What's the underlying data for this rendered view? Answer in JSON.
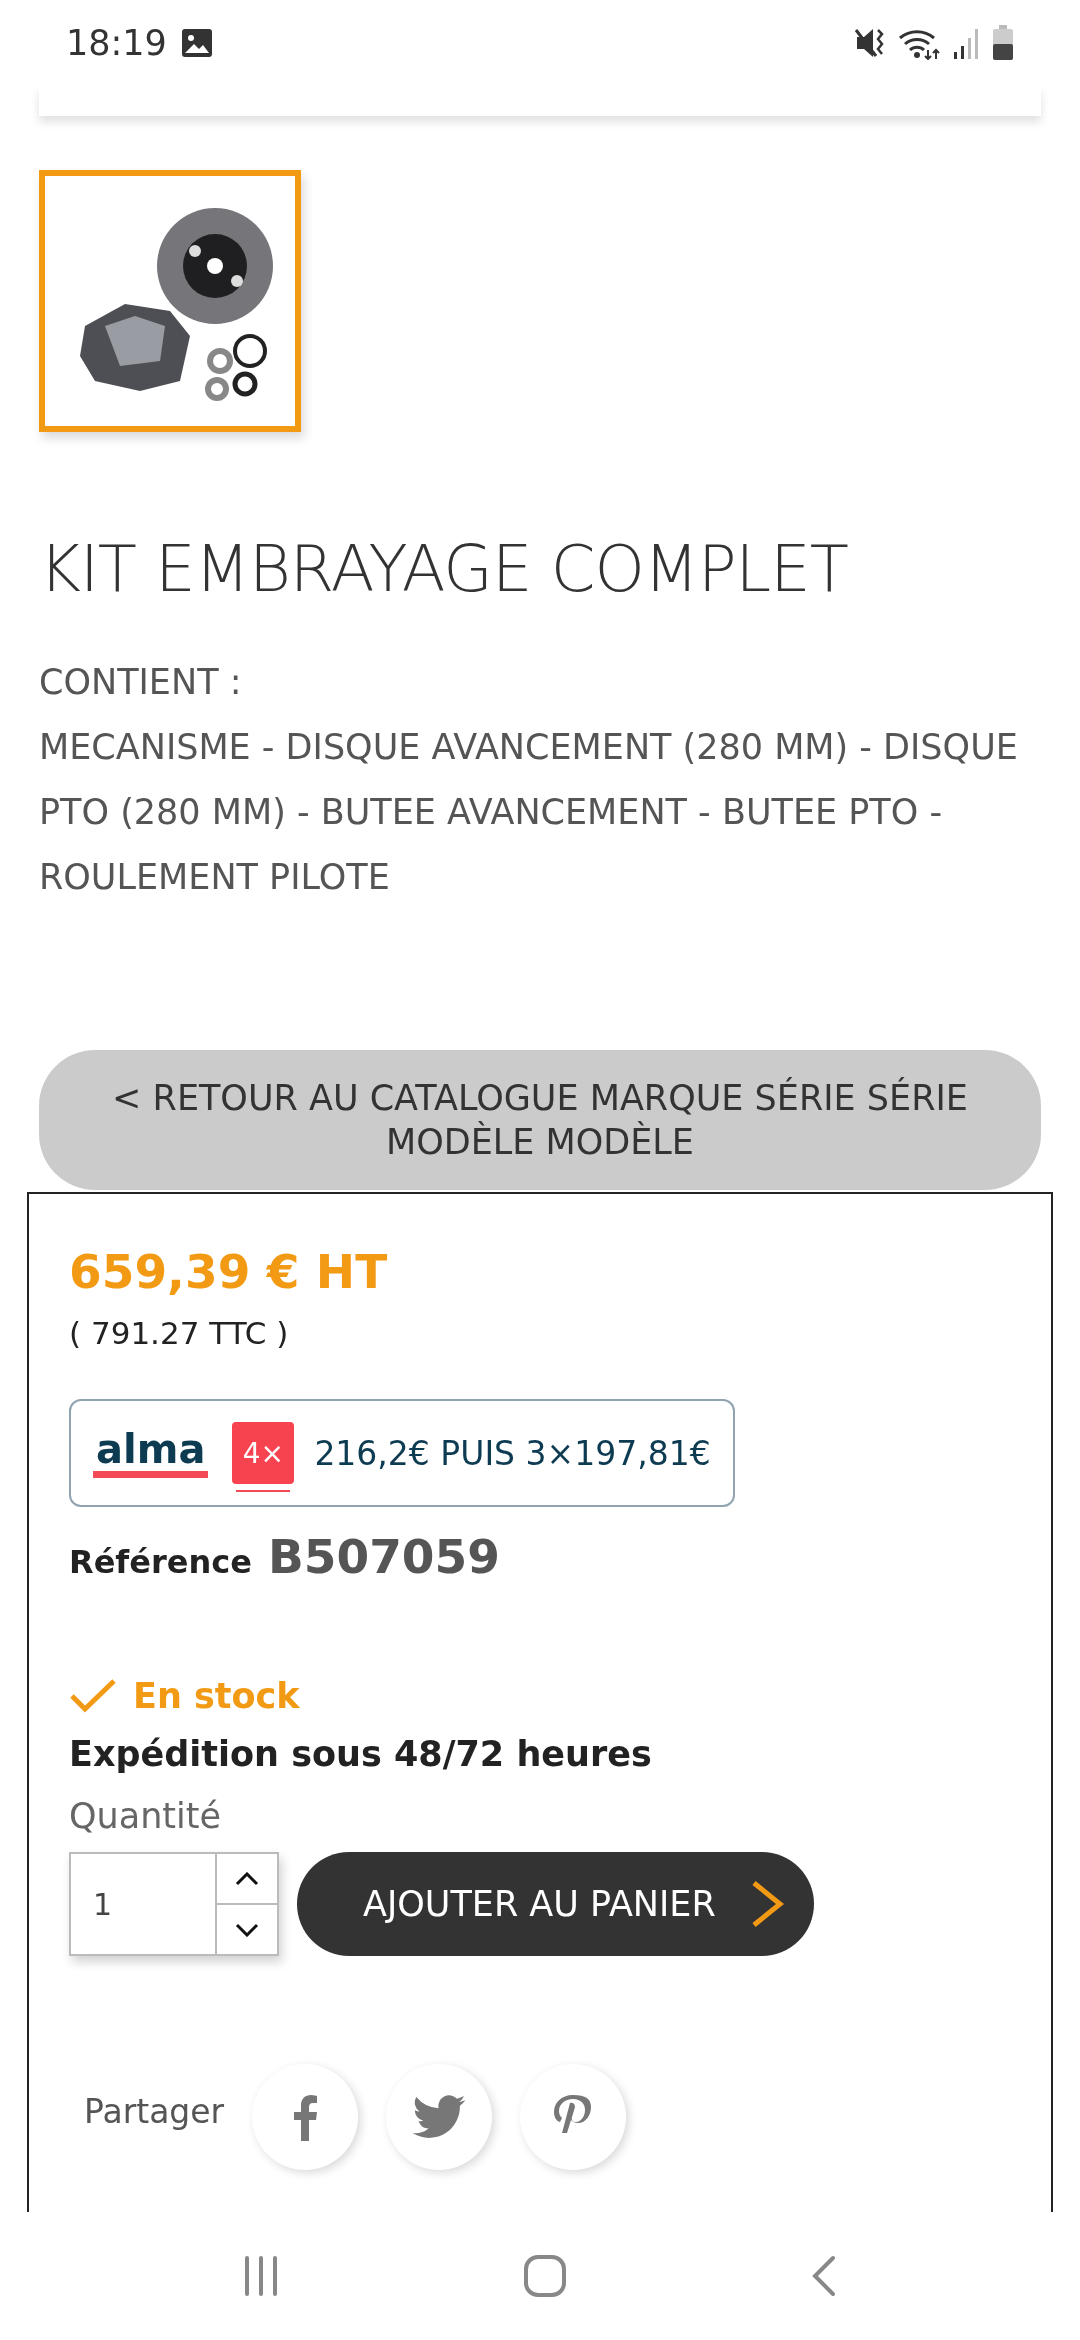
{
  "status_bar": {
    "time": "18:19"
  },
  "thumbnails": [
    {
      "kind": "picture",
      "selected": true
    }
  ],
  "product": {
    "title": "KIT EMBRAYAGE COMPLET",
    "contents_label": "CONTIENT :",
    "contents": "MECANISME - DISQUE AVANCEMENT (280 MM) - DISQUE PTO (280 MM) - BUTEE AVANCEMENT - BUTEE PTO - ROULEMENT PILOTE"
  },
  "back_button": {
    "label": "< RETOUR AU CATALOGUE MARQUE SÉRIE SÉRIE MODÈLE MODÈLE"
  },
  "purchase": {
    "price": "659,39 € HT",
    "price_ttc": "( 791.27 TTC )",
    "alma": {
      "logo": "alma",
      "badge": "4×",
      "text": "216,2€ PUIS 3×197,81€"
    },
    "reference_label": "Référence",
    "reference": "B507059",
    "stock": "En stock",
    "shipping": "Expédition sous 48/72 heures",
    "quantity_label": "Quantité",
    "quantity": "1",
    "add_to_cart": "AJOUTER AU PANIER",
    "share_label": "Partager",
    "share_buttons": [
      {
        "kind": "facebook"
      },
      {
        "kind": "twitter"
      },
      {
        "kind": "pinterest"
      }
    ]
  }
}
